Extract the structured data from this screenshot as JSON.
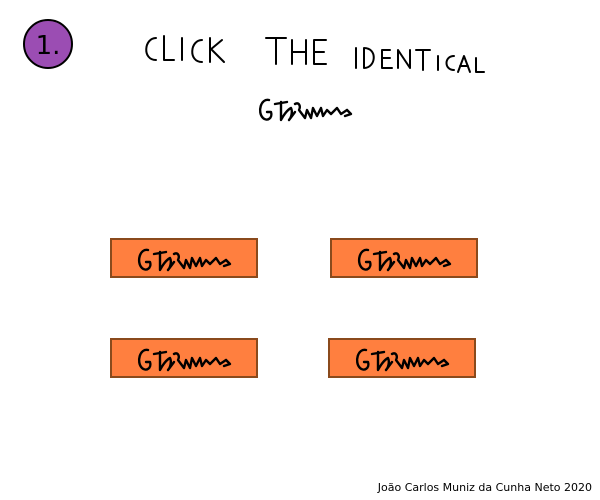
{
  "level": {
    "number": "1.",
    "badge_color": "#9b4db3"
  },
  "instruction": {
    "text": "CLICK THE IDENTICAL"
  },
  "target": {
    "glyph": "scribble-word"
  },
  "options": [
    {
      "glyph": "scribble-word"
    },
    {
      "glyph": "scribble-word"
    },
    {
      "glyph": "scribble-word"
    },
    {
      "glyph": "scribble-word"
    }
  ],
  "colors": {
    "option_fill": "#ff7f3f",
    "option_border": "#8a4a1c"
  },
  "credit": {
    "text": "João Carlos Muniz da Cunha Neto 2020"
  }
}
